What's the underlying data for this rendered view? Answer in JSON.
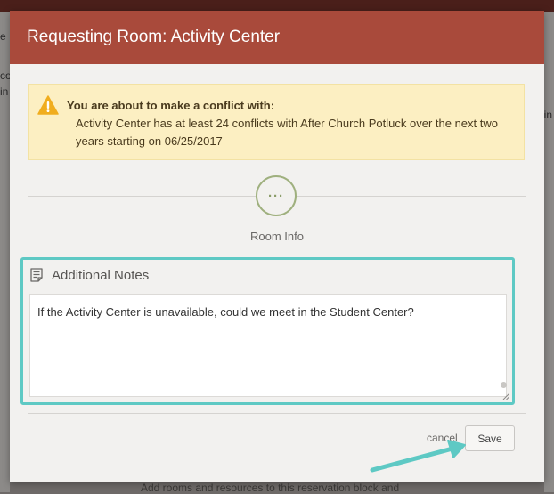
{
  "background": {
    "left_fragments": [
      "e",
      "co",
      "in"
    ],
    "right_fragment": "lin",
    "bottom_text": "Add rooms and resources to this reservation block and"
  },
  "modal": {
    "title": "Requesting Room: Activity Center",
    "header_color": "#a94a3b"
  },
  "alert": {
    "icon": "warning-icon",
    "title": "You are about to make a conflict with:",
    "message": "Activity Center has at least 24 conflicts with After Church Potluck over the next two years starting on 06/25/2017"
  },
  "step": {
    "indicator": "···",
    "label": "Room Info"
  },
  "notes": {
    "icon": "notes-icon",
    "title": "Additional Notes",
    "value": "If the Activity Center is unavailable, could we meet in the Student Center?",
    "highlight_color": "#5ec9c4"
  },
  "footer": {
    "cancel_label": "cancel",
    "save_label": "Save"
  }
}
